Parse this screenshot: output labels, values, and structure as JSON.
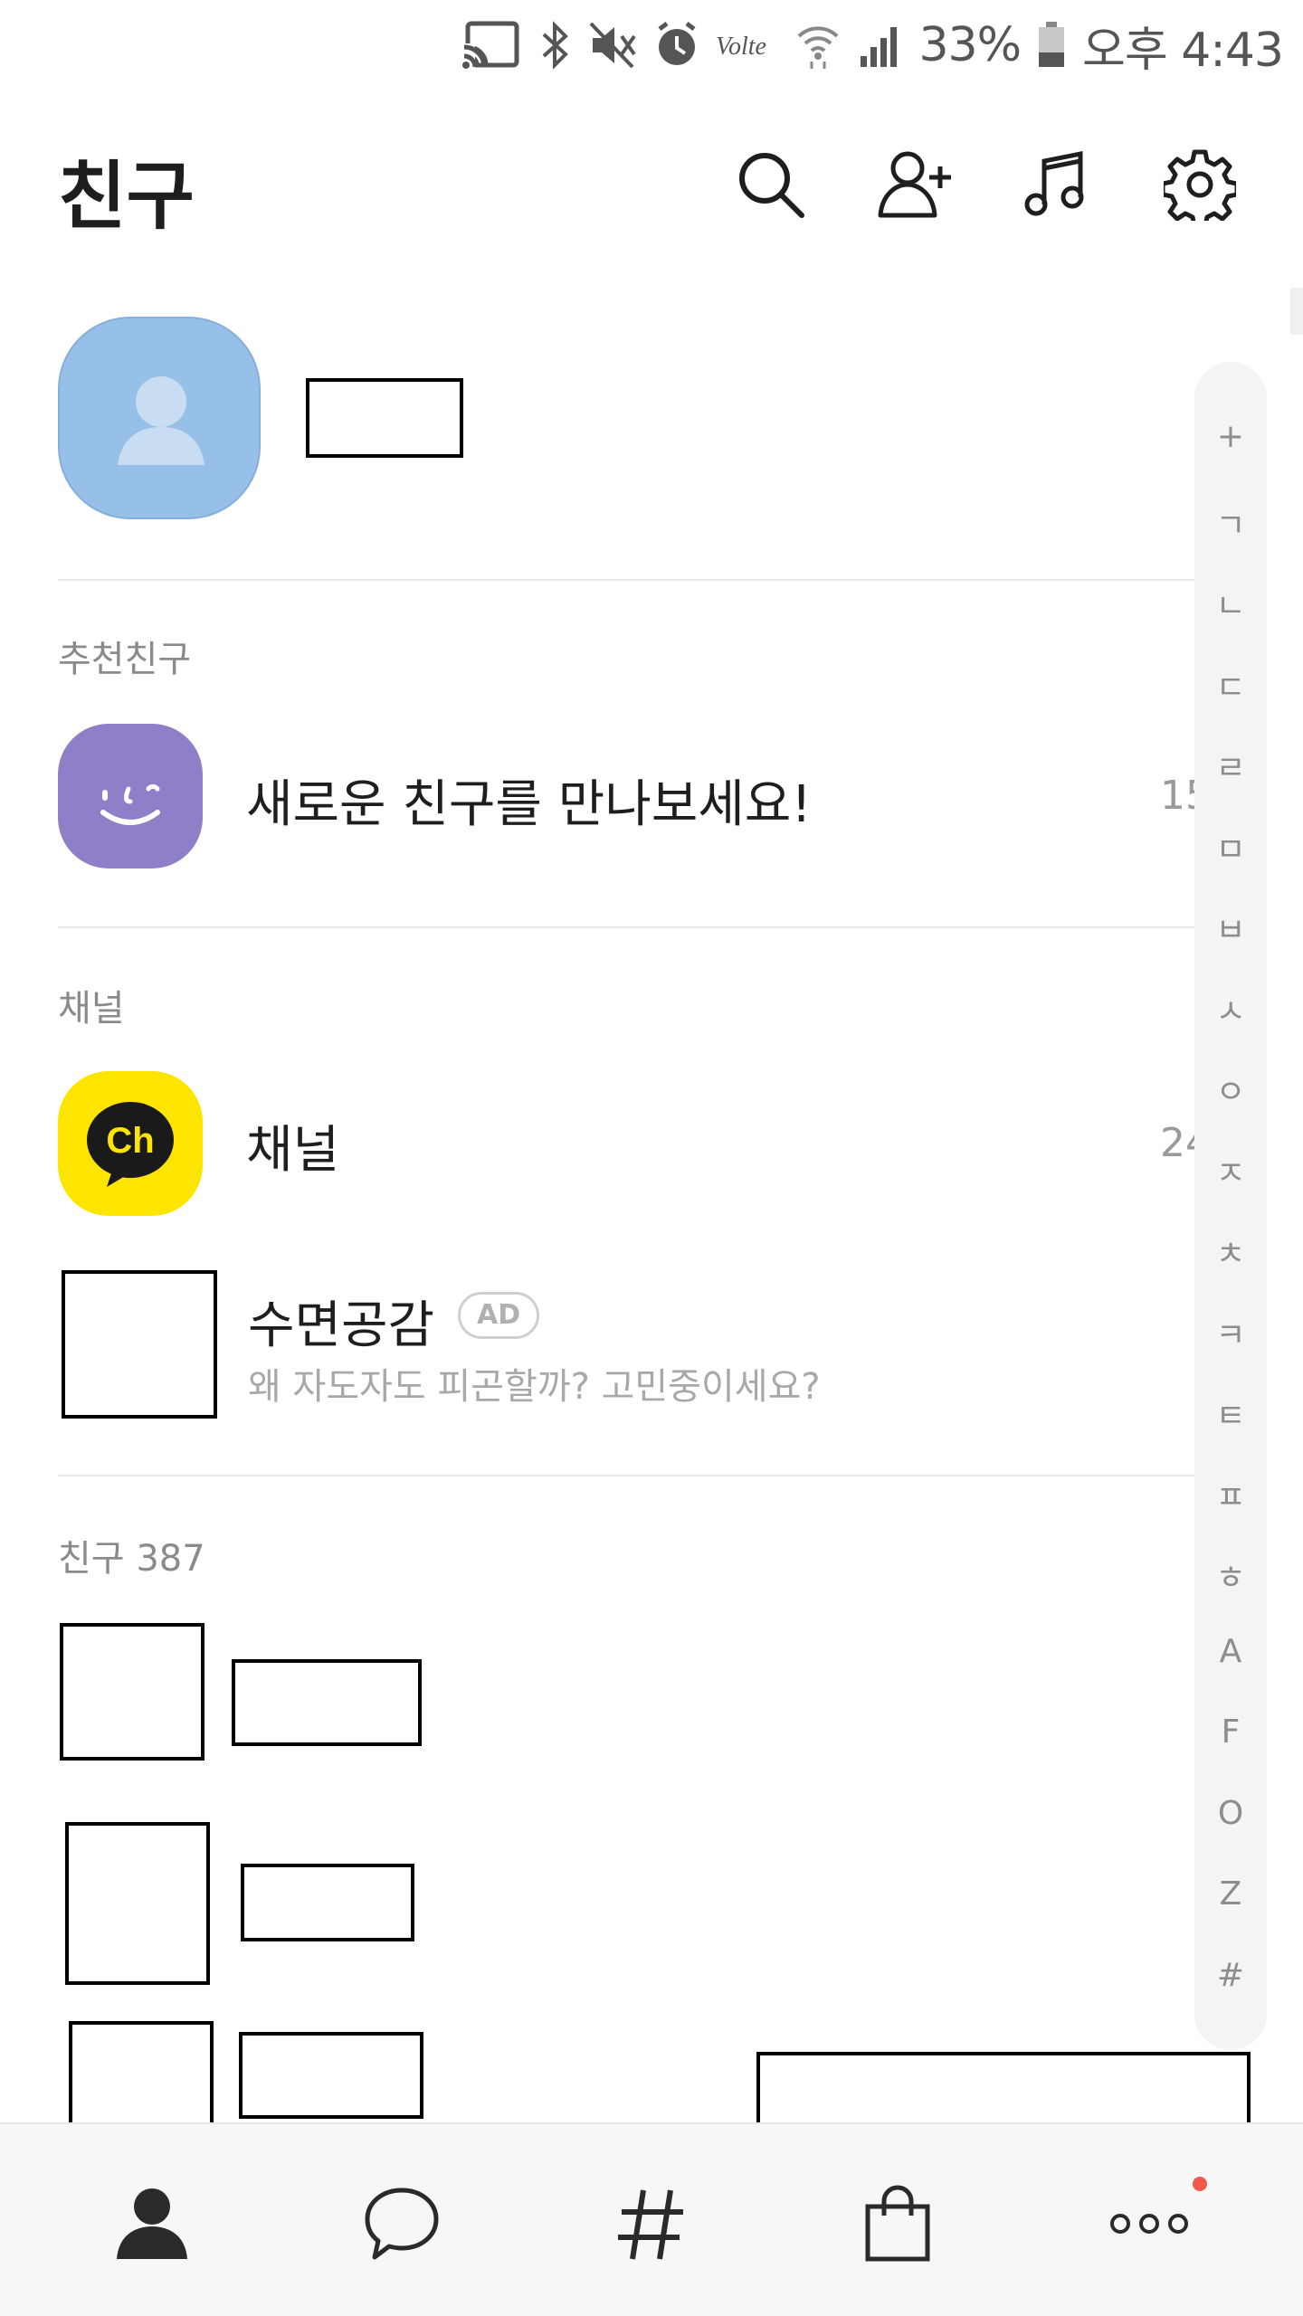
{
  "status_bar": {
    "battery_percent": "33%",
    "time": "오후 4:43",
    "icons": [
      "cast-icon",
      "bluetooth-icon",
      "mute-icon",
      "alarm-icon",
      "volte-icon",
      "wifi-icon",
      "signal-icon",
      "battery-icon"
    ]
  },
  "header": {
    "title": "친구",
    "icons": [
      "search-icon",
      "add-friend-icon",
      "music-icon",
      "settings-icon"
    ]
  },
  "sections": {
    "recommended": {
      "label": "추천친구",
      "title": "새로운 친구를 만나보세요!",
      "count": "15"
    },
    "channel": {
      "label": "채널",
      "title": "채널",
      "count": "24",
      "ad": {
        "name": "수면공감",
        "badge": "AD",
        "subtitle": "왜 자도자도 피곤할까? 고민중이세요?"
      }
    },
    "friends": {
      "label": "친구 387"
    }
  },
  "index_bar": [
    "+",
    "ㄱ",
    "ㄴ",
    "ㄷ",
    "ㄹ",
    "ㅁ",
    "ㅂ",
    "ㅅ",
    "ㅇ",
    "ㅈ",
    "ㅊ",
    "ㅋ",
    "ㅌ",
    "ㅍ",
    "ㅎ",
    "A",
    "F",
    "O",
    "Z",
    "#"
  ],
  "bottom_nav": {
    "tabs": [
      "friends-tab",
      "chats-tab",
      "hashtag-tab",
      "shopping-tab",
      "more-tab"
    ],
    "accent": "#ef5a4a"
  },
  "colors": {
    "profile_avatar": "#97c0e8",
    "recommend_avatar": "#8f7fc8",
    "channel_yellow": "#fde500"
  }
}
